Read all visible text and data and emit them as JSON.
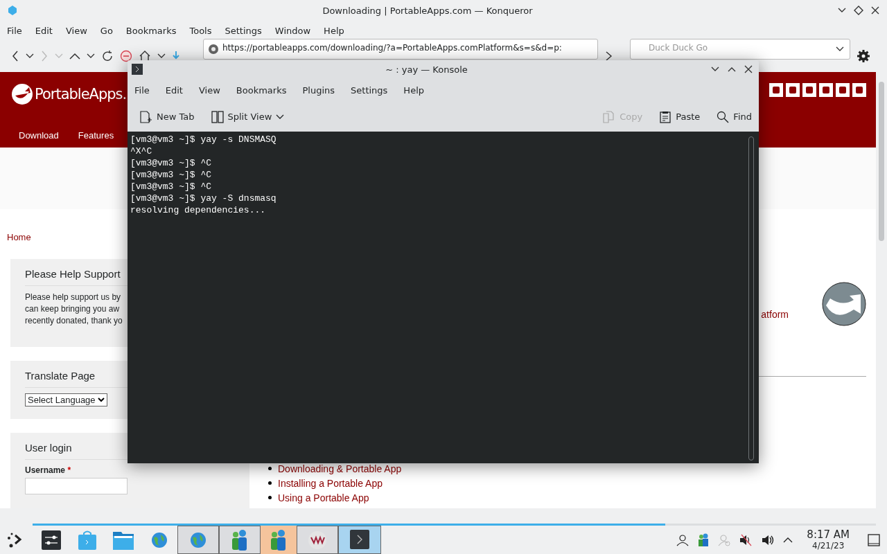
{
  "window": {
    "title": "Downloading | PortableApps.com — Konqueror"
  },
  "menubar": [
    "File",
    "Edit",
    "View",
    "Go",
    "Bookmarks",
    "Tools",
    "Settings",
    "Window",
    "Help"
  ],
  "toolbar": {
    "url": "https://portableapps.com/downloading/?a=PortableApps.comPlatform&s=s&d=p:",
    "search_placeholder": "Duck Duck Go"
  },
  "page": {
    "logo_text": "PortableApps.",
    "nav": [
      "Download",
      "Features"
    ],
    "breadcrumb": "Home",
    "support": {
      "title": "Please Help Support",
      "lines": [
        "Please help support us by",
        "can keep bringing you aw",
        "recently donated, thank yo"
      ]
    },
    "translate": {
      "title": "Translate Page",
      "select": "Select Language"
    },
    "login": {
      "title": "User login",
      "username_label": "Username",
      "required_mark": "*"
    },
    "main_link": "atform",
    "links": [
      "Downloading & Portable App",
      "Installing a Portable App",
      "Using a Portable App"
    ]
  },
  "konsole": {
    "title": "~ : yay — Konsole",
    "menu": [
      "File",
      "Edit",
      "View",
      "Bookmarks",
      "Plugins",
      "Settings",
      "Help"
    ],
    "toolbar": [
      {
        "kind": "newtab",
        "label": "New Tab",
        "disabled": false
      },
      {
        "kind": "split",
        "label": "Split View",
        "disabled": false
      },
      {
        "kind": "copy",
        "label": "Copy",
        "disabled": true
      },
      {
        "kind": "paste",
        "label": "Paste",
        "disabled": false
      },
      {
        "kind": "find",
        "label": "Find",
        "disabled": false
      }
    ],
    "lines": [
      "[vm3@vm3 ~]$ yay -s DNSMASQ",
      "^X^C",
      "[vm3@vm3 ~]$ ^C",
      "[vm3@vm3 ~]$ ^C",
      "[vm3@vm3 ~]$ ^C",
      "[vm3@vm3 ~]$ yay -S dnsmasq",
      "resolving dependencies..."
    ]
  },
  "taskbar": {
    "progress": {
      "level": 0.75
    },
    "tasks": [
      {
        "kind": "settings",
        "selected": false,
        "attention": false
      },
      {
        "kind": "store",
        "selected": false,
        "attention": false
      },
      {
        "kind": "folder",
        "selected": false,
        "attention": false
      },
      {
        "kind": "globe",
        "selected": false,
        "attention": false
      },
      {
        "kind": "globe",
        "selected": true,
        "attention": false
      },
      {
        "kind": "users",
        "selected": true,
        "attention": false
      },
      {
        "kind": "users",
        "selected": false,
        "attention": true
      },
      {
        "kind": "vm",
        "selected": true,
        "attention": false
      },
      {
        "kind": "terminal",
        "selected": true,
        "attention": false
      }
    ],
    "time": "8:17 AM",
    "date": "4/21/23"
  }
}
